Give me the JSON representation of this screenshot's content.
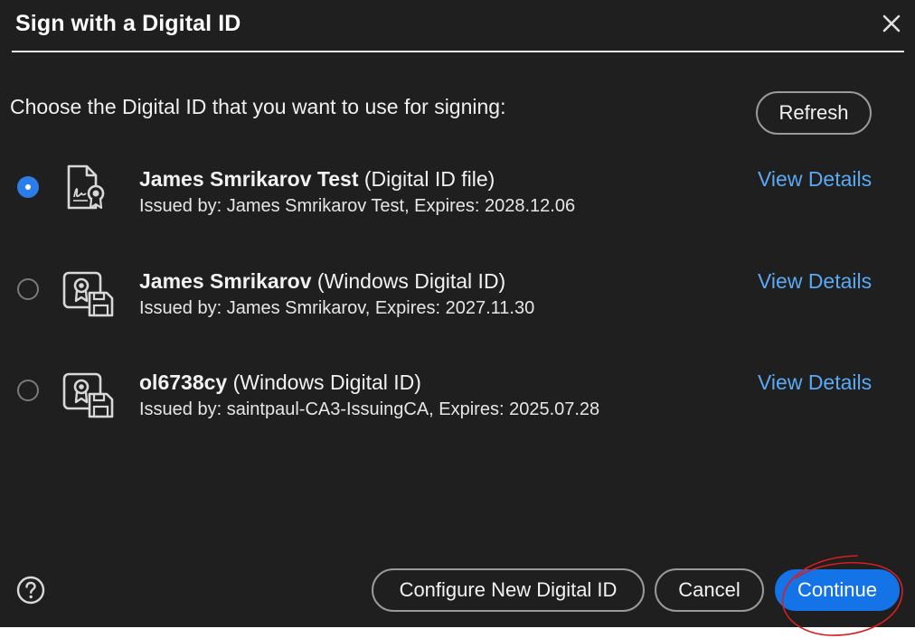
{
  "dialog": {
    "title": "Sign with a Digital ID",
    "close_icon": "close-icon",
    "prompt": "Choose the Digital ID that you want to use for signing:",
    "refresh_label": "Refresh",
    "help_icon": "help-icon"
  },
  "digital_ids": [
    {
      "name": "James Smrikarov Test",
      "type": "(Digital ID file)",
      "issued": "Issued by: James Smrikarov Test, Expires: 2028.12.06",
      "view_details": "View Details",
      "selected": true,
      "icon": "digital-id-file-icon"
    },
    {
      "name": "James Smrikarov",
      "type": "(Windows Digital ID)",
      "issued": "Issued by: James Smrikarov, Expires: 2027.11.30",
      "view_details": "View Details",
      "selected": false,
      "icon": "windows-digital-id-icon"
    },
    {
      "name": "ol6738cy",
      "type": "(Windows Digital ID)",
      "issued": "Issued by: saintpaul-CA3-IssuingCA, Expires: 2025.07.28",
      "view_details": "View Details",
      "selected": false,
      "icon": "windows-digital-id-icon"
    }
  ],
  "footer": {
    "configure_label": "Configure New Digital ID",
    "cancel_label": "Cancel",
    "continue_label": "Continue"
  },
  "colors": {
    "background": "#1f1f1f",
    "accent": "#1473e6",
    "link": "#5aa9f4",
    "annotation": "#d81e1e"
  }
}
